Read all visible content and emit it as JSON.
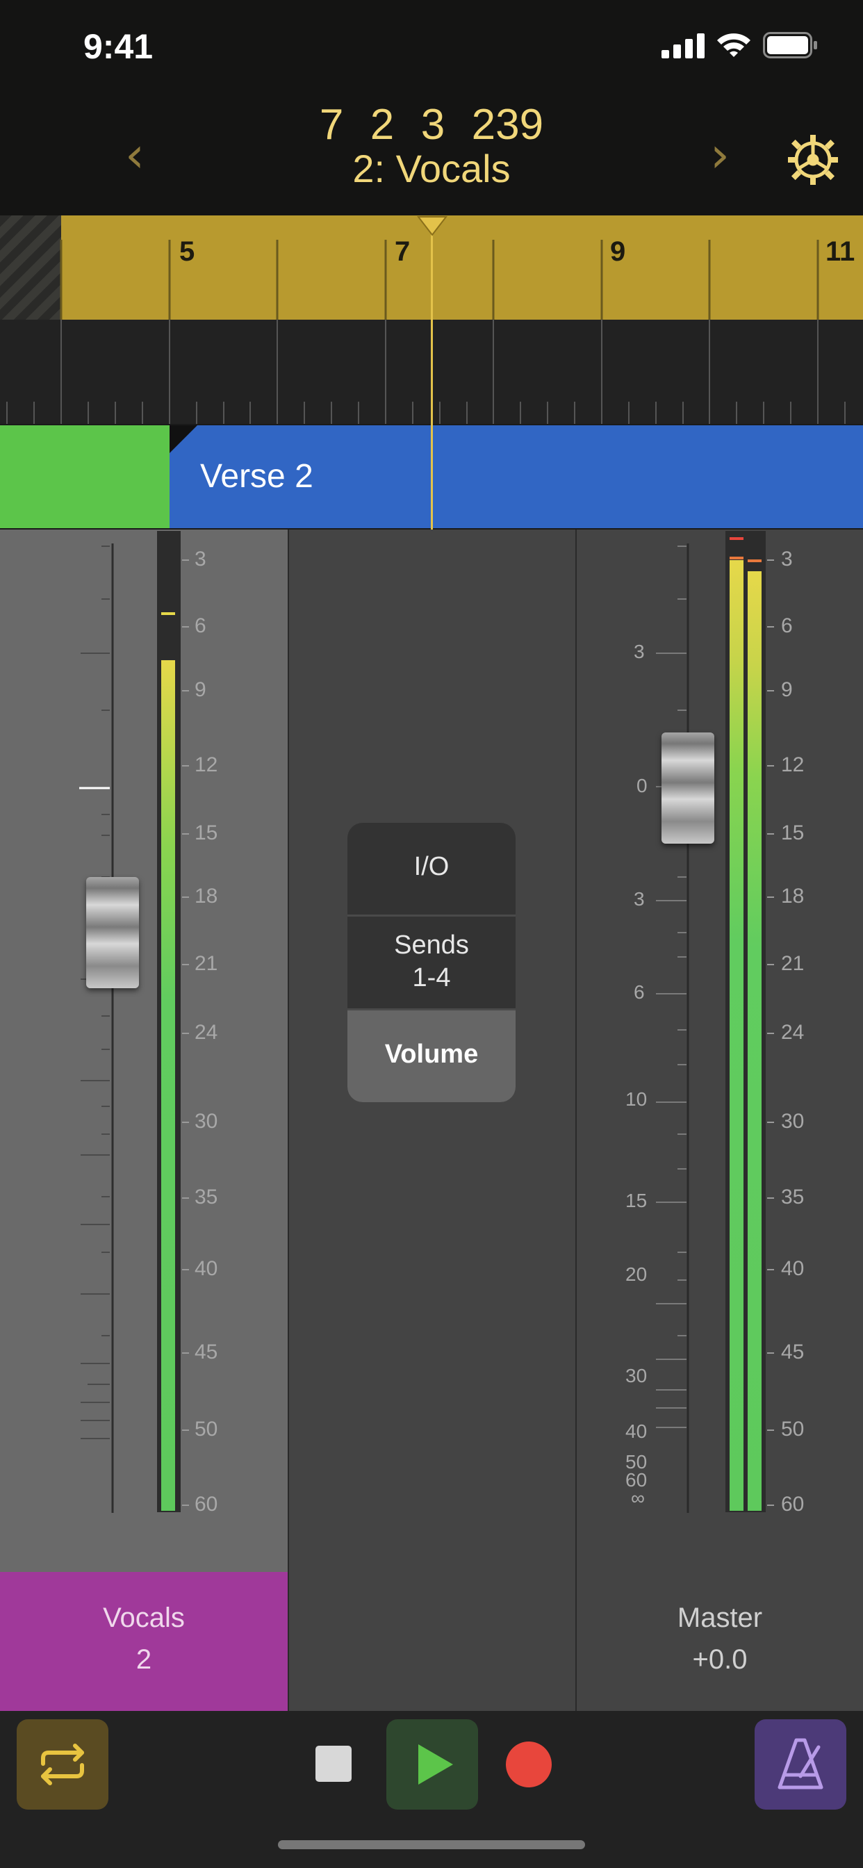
{
  "status": {
    "time": "9:41"
  },
  "header": {
    "position": {
      "bar": "7",
      "beat": "2",
      "division": "3",
      "tick": "239"
    },
    "track": "2: Vocals"
  },
  "ruler": {
    "labels": [
      "5",
      "7",
      "9",
      "11"
    ]
  },
  "region": {
    "name": "Verse 2"
  },
  "meter_scale": [
    "3",
    "6",
    "9",
    "12",
    "15",
    "18",
    "21",
    "24",
    "30",
    "35",
    "40",
    "45",
    "50",
    "60"
  ],
  "fader_scale": [
    "3",
    "0",
    "3",
    "6",
    "10",
    "15",
    "20",
    "30",
    "40",
    "50",
    "60",
    "∞"
  ],
  "menu": {
    "io": "I/O",
    "sends_line1": "Sends",
    "sends_line2": "1-4",
    "volume": "Volume"
  },
  "channels": {
    "vocals": {
      "name": "Vocals",
      "number": "2",
      "color": "#a0399a"
    },
    "master": {
      "name": "Master",
      "value": "+0.0"
    }
  },
  "colors": {
    "accent": "#f1d77a",
    "ruler": "#b89a2f",
    "region_green": "#5cc54a",
    "region_blue": "#3166c4",
    "record": "#e8463c",
    "play": "#5cc54a"
  }
}
